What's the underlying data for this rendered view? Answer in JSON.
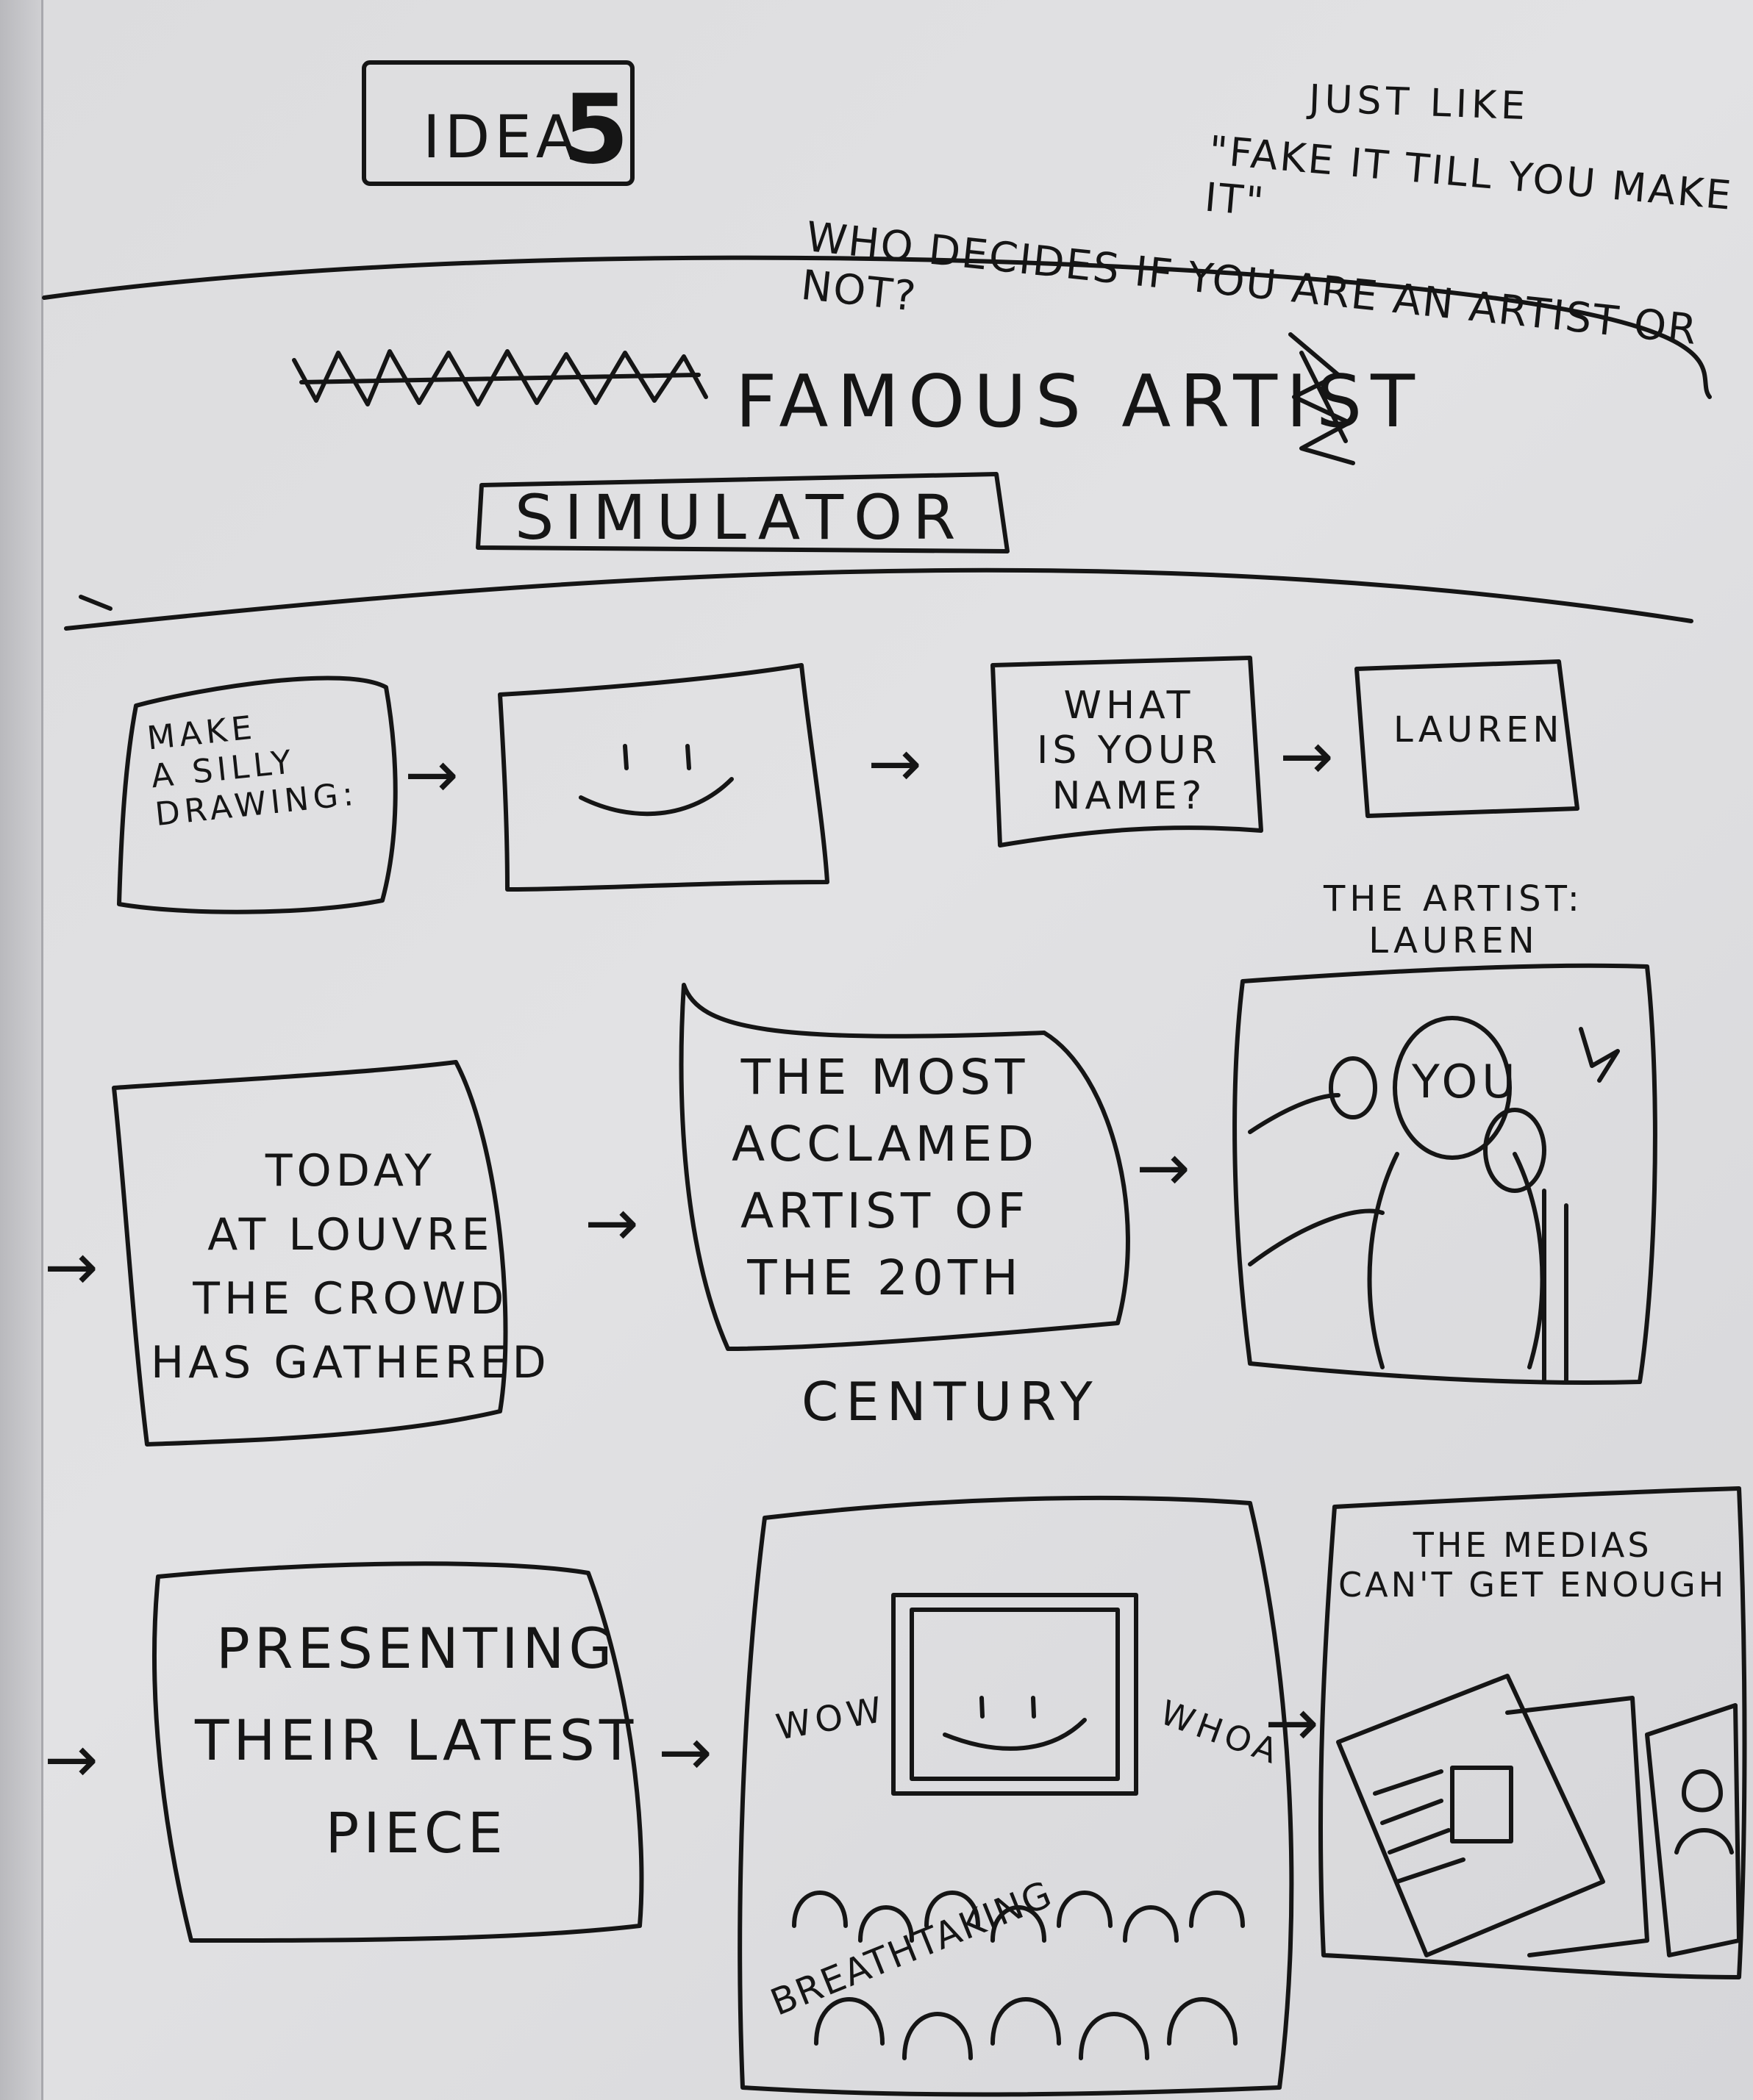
{
  "header": {
    "idea_label": "IDEA",
    "idea_number": "5",
    "note_line1": "JUST LIKE",
    "note_line2": "\"FAKE IT TILL YOU MAKE IT\"",
    "note_line3": "WHO DECIDES IF YOU ARE AN ARTIST OR NOT?"
  },
  "title": {
    "main": "FAMOUS ARTIST",
    "sub": "SIMULATOR"
  },
  "row1": {
    "panel1": "MAKE\nA SILLY\nDRAWING:",
    "panel3": "WHAT\nIS YOUR\nNAME?",
    "panel4": "LAUREN"
  },
  "row2": {
    "panel1": "TODAY\nAT LOUVRE\nTHE CROWD\nHAS GATHERED",
    "panel2": "THE MOST\nACCLAMED\nARTIST OF\nTHE 20TH",
    "panel2_tail": "CENTURY",
    "panel3_caption": "THE ARTIST:\nLAUREN",
    "panel3_label": "YOU"
  },
  "row3": {
    "panel1": "PRESENTING\nTHEIR LATEST\nPIECE",
    "panel2_left": "WOW",
    "panel2_right": "WHOA",
    "panel2_bottom": "BREATHTAKING",
    "panel3_caption": "THE MEDIAS\nCAN'T GET ENOUGH"
  },
  "arrows": {
    "glyph": "→"
  }
}
